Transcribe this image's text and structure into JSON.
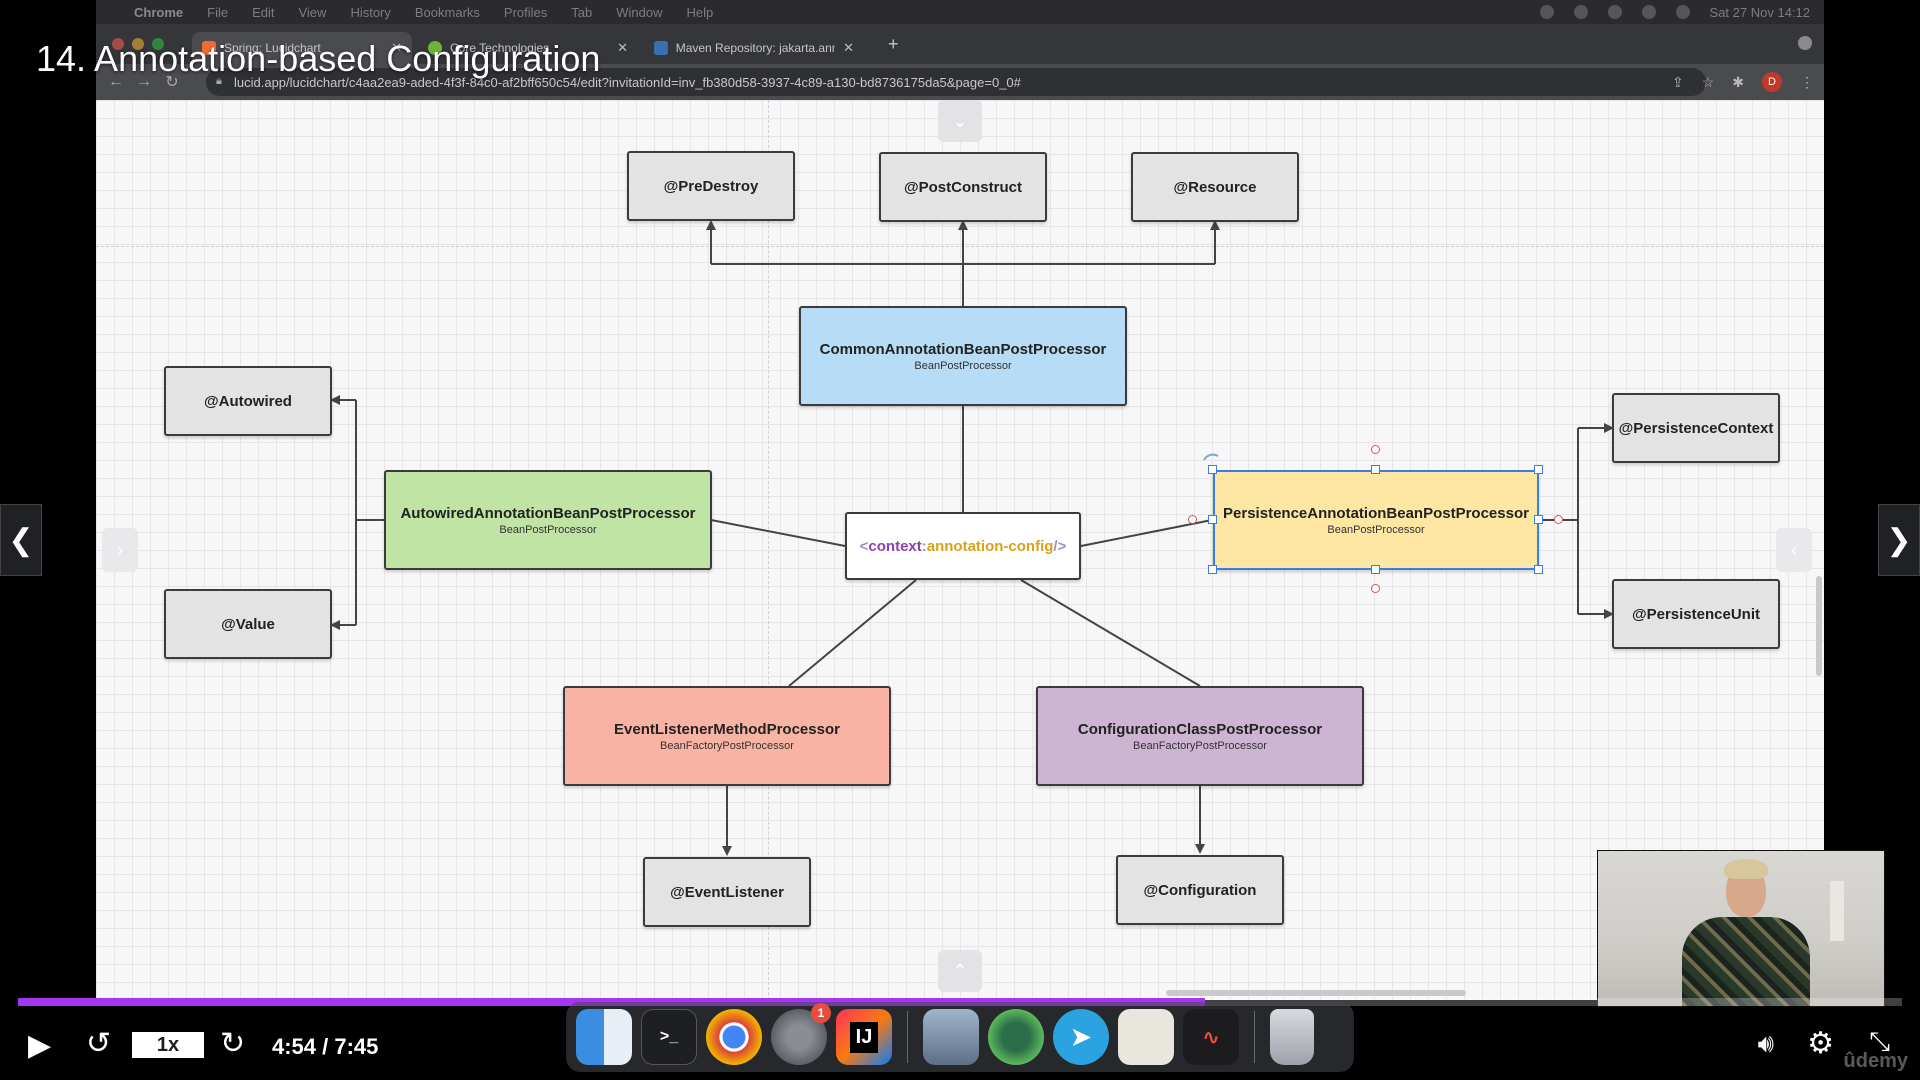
{
  "lesson": {
    "title": "14. Annotation-based Configuration"
  },
  "menubar": {
    "app": "Chrome",
    "items": [
      "File",
      "Edit",
      "View",
      "History",
      "Bookmarks",
      "Profiles",
      "Tab",
      "Window",
      "Help"
    ],
    "datetime": "Sat 27 Nov  14:12"
  },
  "browser": {
    "tabs": [
      {
        "title": "Spring: Lucidchart",
        "favicon": "lucid-icon",
        "active": true
      },
      {
        "title": "Core Technologies",
        "favicon": "spring-icon",
        "active": false
      },
      {
        "title": "Maven Repository: jakarta.ann",
        "favicon": "maven-icon",
        "active": false
      }
    ],
    "new_tab_label": "+",
    "url": "lucid.app/lucidchart/c4aa2ea9-aded-4f3f-84c0-af2bff650c54/edit?invitationId=inv_fb380d58-3937-4c89-a130-bd8736175da5&page=0_0#",
    "profile_initial": "D"
  },
  "diagram": {
    "predestroy": "@PreDestroy",
    "postconstruct": "@PostConstruct",
    "resource": "@Resource",
    "common_title": "CommonAnnotationBeanPostProcessor",
    "common_sub": "BeanPostProcessor",
    "autowired": "@Autowired",
    "value": "@Value",
    "autowired_proc_title": "AutowiredAnnotationBeanPostProcessor",
    "autowired_proc_sub": "BeanPostProcessor",
    "context_open": "<",
    "context_kw": "context",
    "context_colon": ":",
    "context_attr": "annotation-config",
    "context_close": "/>",
    "persistence_title": "PersistenceAnnotationBeanPostProcessor",
    "persistence_sub": "BeanPostProcessor",
    "persistence_context": "@PersistenceContext",
    "persistence_unit": "@PersistenceUnit",
    "eventlistener_proc_title": "EventListenerMethodProcessor",
    "eventlistener_proc_sub": "BeanFactoryPostProcessor",
    "eventlistener": "@EventListener",
    "config_proc_title": "ConfigurationClassPostProcessor",
    "config_proc_sub": "BeanFactoryPostProcessor",
    "configuration": "@Configuration",
    "colors": {
      "common": "#b7dcf5",
      "autowired_proc": "#bfe4a3",
      "persistence": "#fde7a2",
      "eventlistener_proc": "#f9b3a5",
      "config_proc": "#cdb4d3",
      "annotation": "#e3e3e3"
    }
  },
  "player": {
    "rate": "1x",
    "time": "4:54 / 7:45",
    "progress": 0.63,
    "watermark": "ûdemy"
  },
  "dock": {
    "apps": [
      "finder-icon",
      "terminal-icon",
      "chrome-icon",
      "system-preferences-icon",
      "intellij-icon",
      "preview-icon",
      "sourcetree-icon",
      "telegram-icon",
      "textedit-icon",
      "voice-memos-icon",
      "trash-icon"
    ],
    "intellij_label": "IJ",
    "terminal_label": ">_",
    "settings_badge": "1"
  }
}
